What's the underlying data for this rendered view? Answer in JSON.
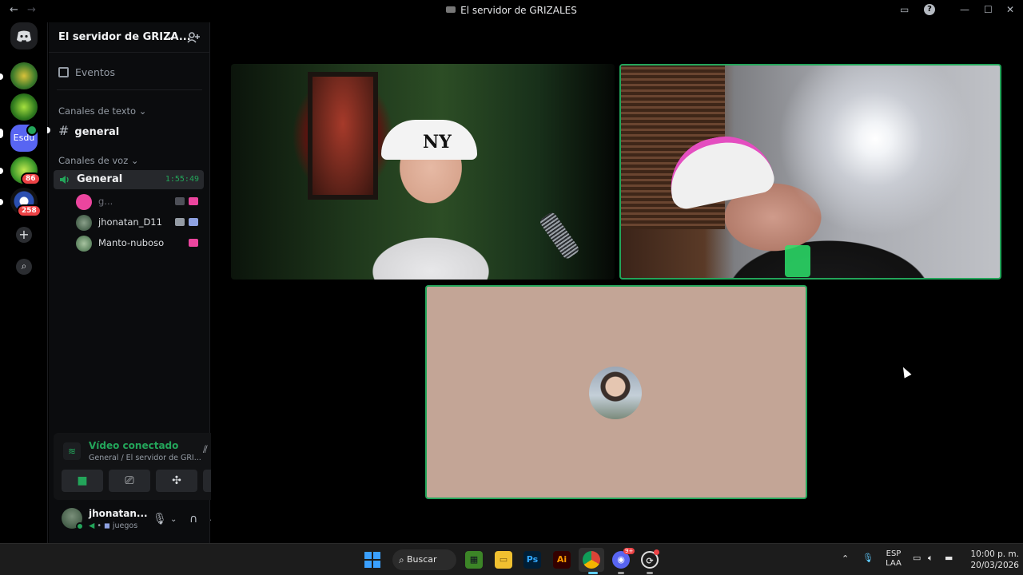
{
  "window": {
    "title": "El servidor de GRIZALES",
    "back_icon": "←",
    "forward_icon": "→"
  },
  "rail": {
    "badges": {
      "server_5": "86",
      "server_6": "258"
    },
    "server_4_label": "Esdu",
    "add_icon": "+",
    "explore_icon": "⌕"
  },
  "sidebar": {
    "server_name": "El servidor de GRIZA...",
    "events_label": "Eventos",
    "text_category": "Canales de texto",
    "text_channel": "general",
    "voice_category": "Canales de voz",
    "voice_channel": "General",
    "voice_timer": "1:55:49",
    "members": [
      {
        "name": "g..."
      },
      {
        "name": "jhonatan_D11"
      },
      {
        "name": "Manto-nuboso"
      }
    ]
  },
  "voice_panel": {
    "status": "Vídeo conectado",
    "location": "General / El servidor de GRI..."
  },
  "user": {
    "name": "jhonatan...",
    "status": "juegos"
  },
  "taskbar": {
    "search_label": "Buscar",
    "lang_top": "ESP",
    "lang_bottom": "LAA",
    "time": "10:00 p. m.",
    "date": "20/03/2026",
    "discord_badge": "9+"
  },
  "colors": {
    "accent_green": "#23a55a",
    "blurple": "#5865f2",
    "danger": "#ed4245"
  }
}
